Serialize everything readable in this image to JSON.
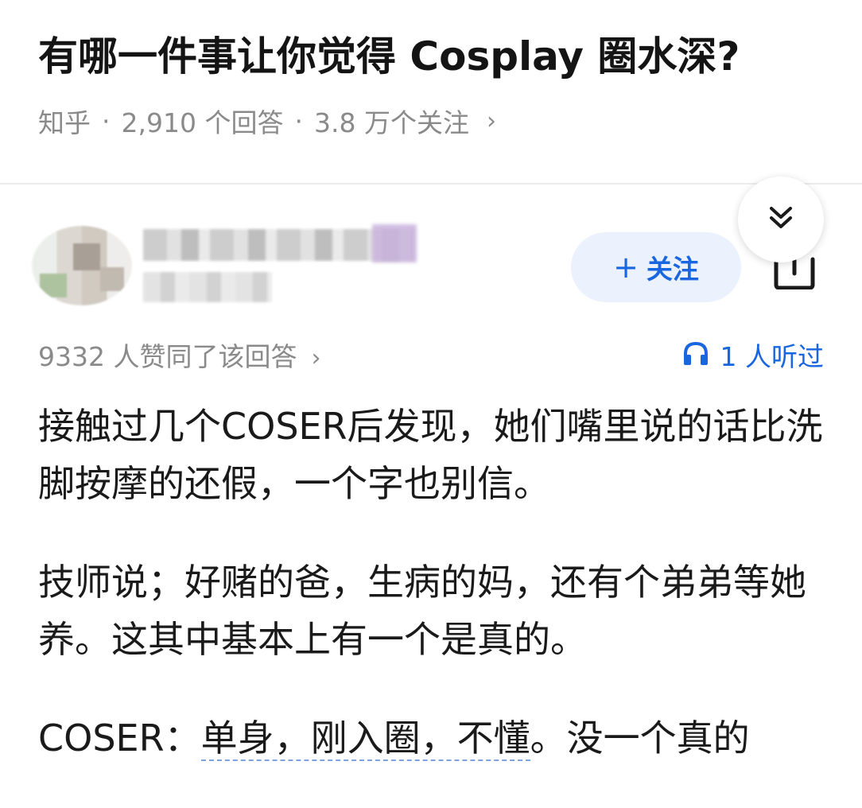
{
  "question": {
    "title": "有哪一件事让你觉得 Cosplay 圈水深?",
    "source": "知乎",
    "answers": "2,910 个回答",
    "followers": "3.8 万个关注",
    "sep": "·"
  },
  "actions": {
    "follow_label": "关注",
    "follow_plus": "+"
  },
  "answer": {
    "votes": "9332 人赞同了该回答",
    "listens": "1 人听过",
    "paragraphs": [
      "接触过几个COSER后发现，她们嘴里说的话比洗脚按摩的还假，一个字也别信。",
      "技师说；好赌的爸，生病的妈，还有个弟弟等她养。这其中基本上有一个是真的。"
    ],
    "p3_prefix": "COSER：",
    "p3_linked": "单身，刚入圈，不懂",
    "p3_suffix": "。没一个真的"
  },
  "icons": {
    "collapse": "double-chevron-down-icon",
    "share": "share-icon",
    "headphones": "headphones-icon",
    "chevron": "chevron-right-icon"
  },
  "colors": {
    "accent": "#1a66e0",
    "follow_bg": "#ebf2fd",
    "meta_gray": "#8a8a8a"
  }
}
